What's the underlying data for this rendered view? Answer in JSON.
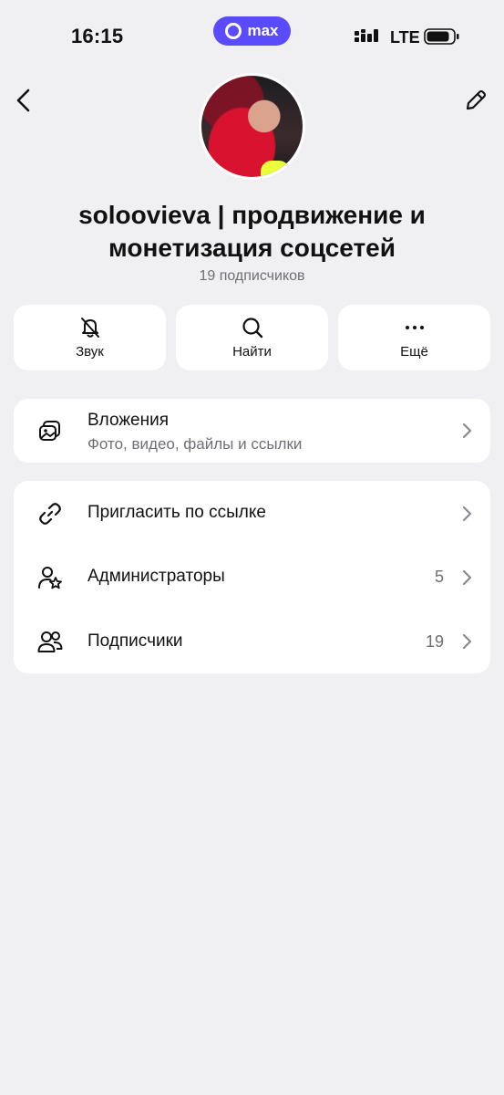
{
  "status_bar": {
    "time": "16:15",
    "app_badge": "max",
    "network": "LTE"
  },
  "channel": {
    "title": "soloovieva | продвижение и монетизация соцсетей",
    "subscribers": "19 подписчиков"
  },
  "actions": [
    {
      "label": "Звук",
      "icon": "bell-off-icon"
    },
    {
      "label": "Найти",
      "icon": "search-icon"
    },
    {
      "label": "Ещё",
      "icon": "more-icon"
    }
  ],
  "attachments": {
    "title": "Вложения",
    "subtitle": "Фото, видео, файлы и ссылки",
    "icon": "media-icon"
  },
  "menu": [
    {
      "label": "Пригласить по ссылке",
      "count": "",
      "icon": "link-icon"
    },
    {
      "label": "Администраторы",
      "count": "5",
      "icon": "admin-icon"
    },
    {
      "label": "Подписчики",
      "count": "19",
      "icon": "users-icon"
    }
  ],
  "colors": {
    "background": "#f0f0f3",
    "accent": "#5b4bff",
    "card": "#ffffff",
    "secondary_text": "#6e6e75"
  }
}
